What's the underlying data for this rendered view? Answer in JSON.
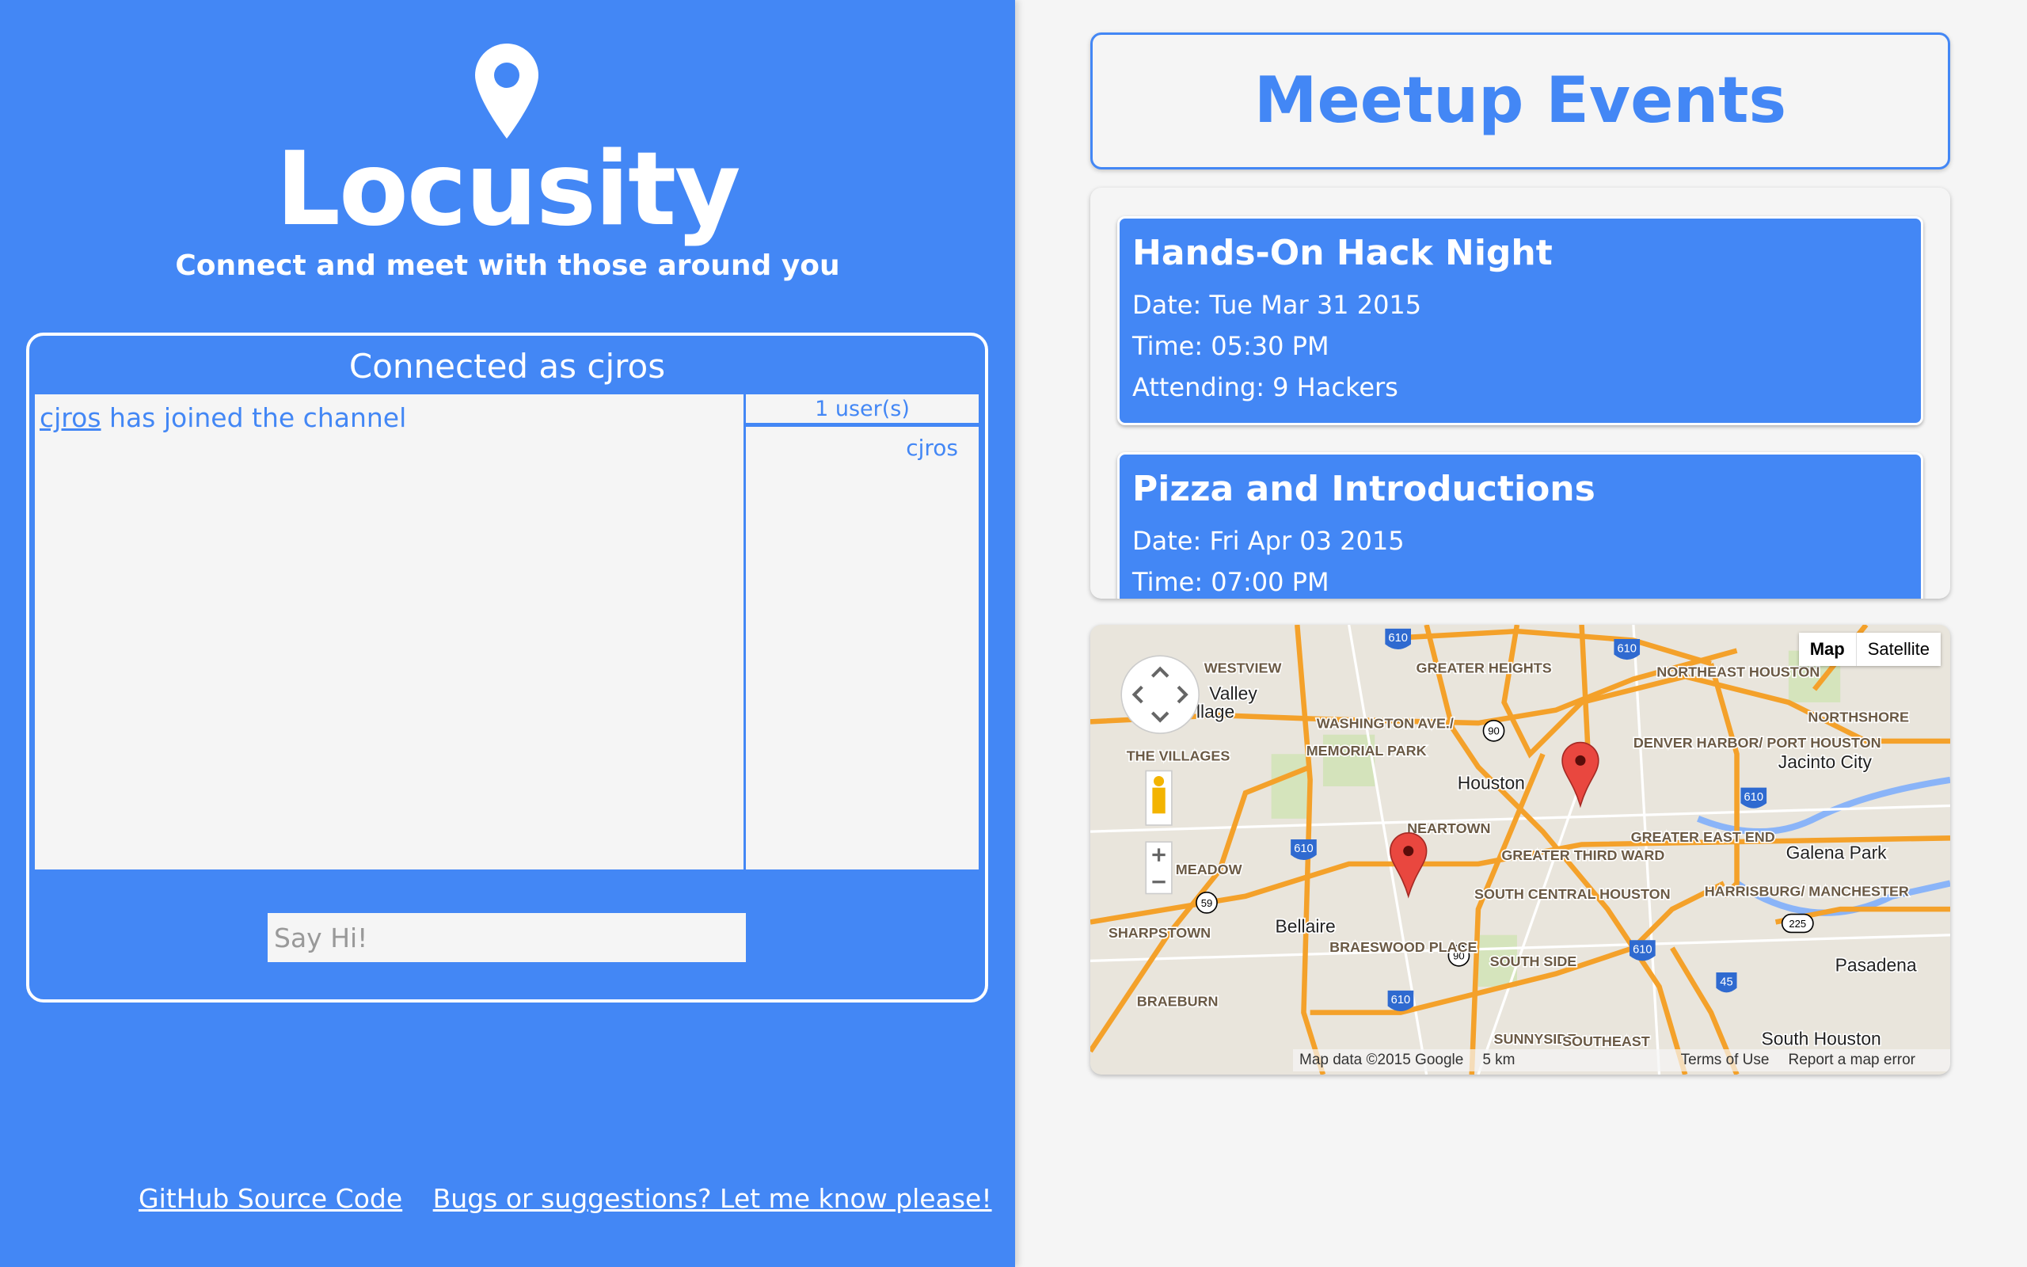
{
  "app": {
    "name": "Locusity",
    "tagline": "Connect and meet with those around you"
  },
  "chat": {
    "title": "Connected as cjros",
    "messages": [
      {
        "user": "cjros",
        "text": " has joined the channel"
      }
    ],
    "users_count": "1 user(s)",
    "users": [
      "cjros"
    ],
    "input_placeholder": "Say Hi!"
  },
  "footer": {
    "github": "GitHub Source Code",
    "feedback": "Bugs or suggestions? Let me know please!"
  },
  "events": {
    "title": "Meetup Events",
    "items": [
      {
        "name": "Hands-On Hack Night",
        "date": "Date: Tue Mar 31 2015",
        "time": "Time: 05:30 PM",
        "attending": "Attending: 9 Hackers"
      },
      {
        "name": "Pizza and Introductions",
        "date": "Date: Fri Apr 03 2015",
        "time": "Time: 07:00 PM"
      }
    ]
  },
  "map": {
    "type_map": "Map",
    "type_satellite": "Satellite",
    "attribution": "Map data ©2015 Google",
    "scale": "5 km",
    "terms": "Terms of Use",
    "report": "Report a map error",
    "labels": {
      "houston": "Houston",
      "bellaire": "Bellaire",
      "pasadena": "Pasadena",
      "galena": "Galena Park",
      "jacinto": "Jacinto City",
      "southhouston": "South Houston",
      "valley": "Valley",
      "village": "llage",
      "westview": "WESTVIEW",
      "heights": "GREATER HEIGHTS",
      "washington": "WASHINGTON AVE./",
      "memorial": "MEMORIAL PARK",
      "villages": "THE VILLAGES",
      "neartown": "NEARTOWN",
      "thirdward": "GREATER THIRD WARD",
      "southcentral": "SOUTH CENTRAL HOUSTON",
      "braeswood": "BRAESWOOD PLACE",
      "southside": "SOUTH SIDE",
      "sharpstown": "SHARPSTOWN",
      "braeburn": "BRAEBURN",
      "northeast": "NORTHEAST HOUSTON",
      "northshore": "NORTHSHORE",
      "denver": "DENVER HARBOR/ PORT HOUSTON",
      "eastend": "GREATER EAST END",
      "harrisburg": "HARRISBURG/ MANCHESTER",
      "sunnyside": "SUNNYSIDE",
      "southeast": "SOUTHEAST",
      "meadow": "MEADOW",
      "i610": "610",
      "us90": "90",
      "us59": "59",
      "i45": "45",
      "r225": "225"
    },
    "markers": 2
  },
  "colors": {
    "accent": "#4387f5",
    "background": "#f5f5f5",
    "marker": "#e9473f",
    "road": "#f4a12a"
  }
}
